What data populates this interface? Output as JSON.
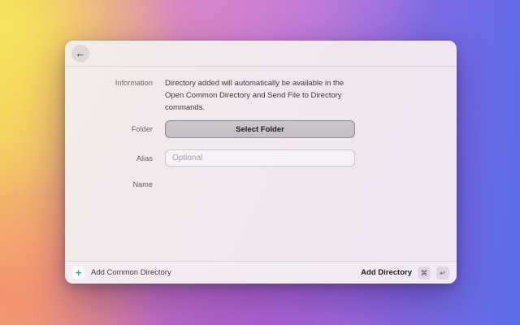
{
  "window": {
    "header": {
      "back_icon": "←"
    },
    "form": {
      "information": {
        "label": "Information",
        "lines": [
          "Directory added will automatically be available in the",
          "Open Common Directory and Send File to Directory",
          "commands."
        ]
      },
      "folder": {
        "label": "Folder",
        "button_label": "Select Folder"
      },
      "alias": {
        "label": "Alias",
        "placeholder": "Optional",
        "value": ""
      },
      "name": {
        "label": "Name",
        "value": ""
      }
    },
    "footer": {
      "add_common": {
        "icon": "+",
        "label": "Add Common Directory"
      },
      "add_directory": {
        "label": "Add Directory",
        "shortcut_keys": [
          "⌘",
          "↵"
        ]
      }
    }
  },
  "colors": {
    "teal_accent": "#2ba8ac",
    "folder_button_bg": "#c7c2c6",
    "folder_button_border": "#8f8a8f",
    "window_bg": "#f0e9ee"
  }
}
